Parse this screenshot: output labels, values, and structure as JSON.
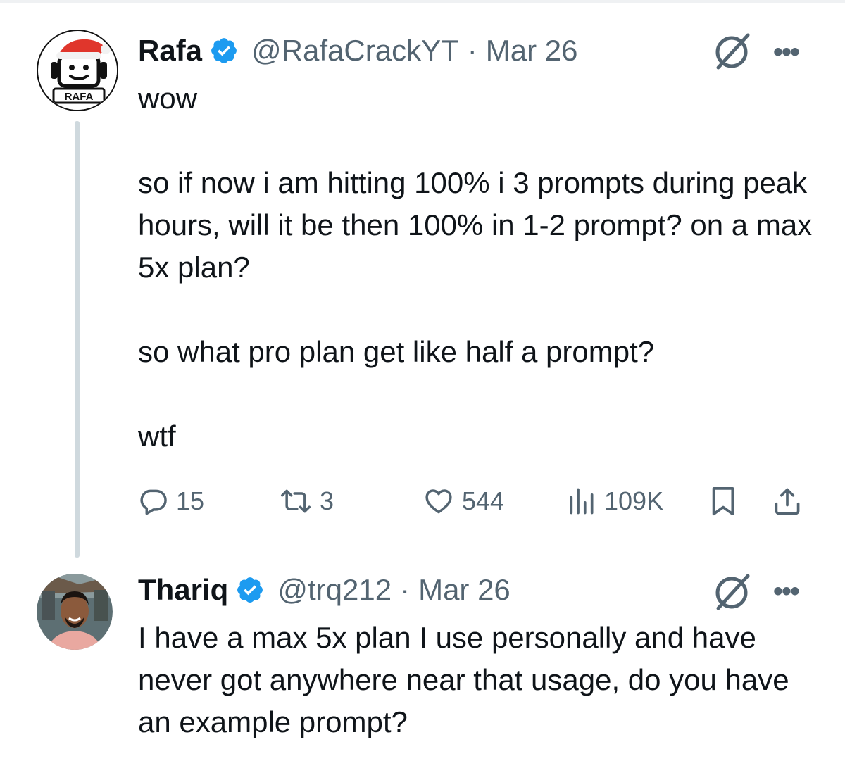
{
  "tweets": [
    {
      "author": {
        "name": "Rafa",
        "handle": "@RafaCrackYT",
        "date": "Mar 26",
        "avatar_label": "RAFA",
        "verified": true
      },
      "paragraphs": [
        "wow",
        "",
        "so if now i am hitting 100% i 3 prompts during peak hours, will it be then 100% in 1-2 prompt? on a max 5x plan?",
        "",
        "so what pro plan get like half a prompt?",
        "",
        "wtf"
      ],
      "stats": {
        "replies": "15",
        "reposts": "3",
        "likes": "544",
        "views": "109K"
      }
    },
    {
      "author": {
        "name": "Thariq",
        "handle": "@trq212",
        "date": "Mar 26",
        "verified": true
      },
      "paragraphs": [
        "I have a max 5x plan I use personally and have never got anywhere near that usage, do you have an example prompt?"
      ]
    }
  ],
  "ui": {
    "dot": "·",
    "more": "•••"
  },
  "icons": [
    "verified-badge-icon",
    "grok-icon",
    "more-icon",
    "reply-icon",
    "repost-icon",
    "like-icon",
    "views-icon",
    "bookmark-icon",
    "share-icon"
  ],
  "colors": {
    "text": "#0f1419",
    "secondary": "#536471",
    "verified": "#1d9bf0",
    "thread_line": "#cfd9de",
    "santa_hat": "#e0362c"
  }
}
